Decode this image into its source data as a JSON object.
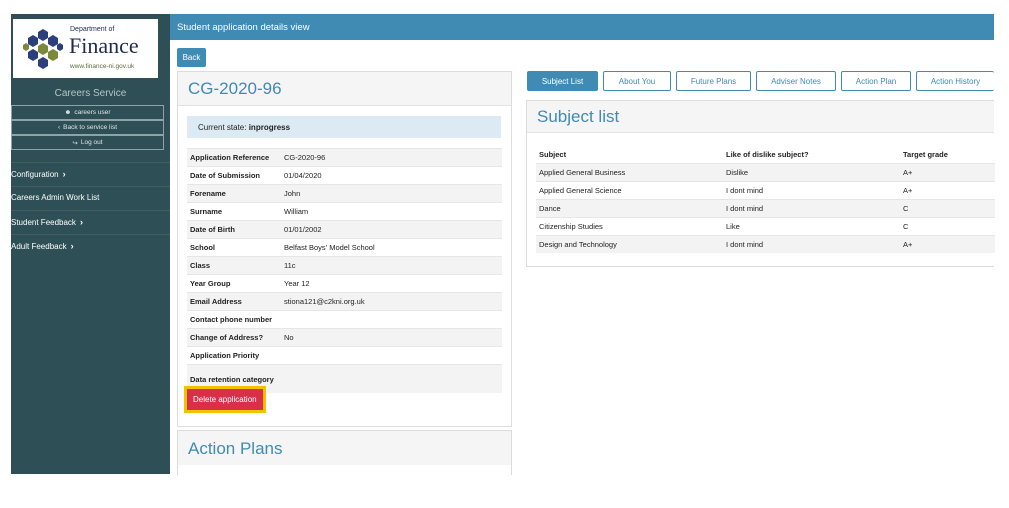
{
  "sidebar": {
    "logo": {
      "dept": "Department of",
      "name": "Finance",
      "url": "www.finance-ni.gov.uk"
    },
    "service_title": "Careers Service",
    "user_links": [
      {
        "icon": "user-icon",
        "glyph": "☻",
        "label": "careers user"
      },
      {
        "icon": "chevron-left-icon",
        "glyph": "‹",
        "label": "Back to service list"
      },
      {
        "icon": "logout-icon",
        "glyph": "↪",
        "label": "Log out"
      }
    ],
    "nav": [
      {
        "label": "Configuration",
        "chevron": "›"
      },
      {
        "label": "Careers Admin Work List",
        "chevron": ""
      },
      {
        "label": "Student Feedback",
        "chevron": "›"
      },
      {
        "label": "Adult Feedback",
        "chevron": "›"
      }
    ]
  },
  "header": {
    "title": "Student application details view",
    "back_label": "Back"
  },
  "application": {
    "reference_title": "CG-2020-96",
    "state_label": "Current state: ",
    "state_value": "inprogress",
    "details": [
      {
        "key": "Application Reference",
        "value": "CG-2020-96"
      },
      {
        "key": "Date of Submission",
        "value": "01/04/2020"
      },
      {
        "key": "Forename",
        "value": "John"
      },
      {
        "key": "Surname",
        "value": "William"
      },
      {
        "key": "Date of Birth",
        "value": "01/01/2002"
      },
      {
        "key": "School",
        "value": "Belfast Boys' Model School"
      },
      {
        "key": "Class",
        "value": "11c"
      },
      {
        "key": "Year Group",
        "value": "Year 12"
      },
      {
        "key": "Email Address",
        "value": "stiona121@c2kni.org.uk"
      },
      {
        "key": "Contact phone number",
        "value": ""
      },
      {
        "key": "Change of Address?",
        "value": "No"
      },
      {
        "key": "Application Priority",
        "value": ""
      },
      {
        "key": "Data retention category",
        "value": ""
      }
    ],
    "delete_label": "Delete application",
    "action_plans_title": "Action Plans"
  },
  "tabs": [
    {
      "label": "Subject List",
      "active": true
    },
    {
      "label": "About You",
      "active": false
    },
    {
      "label": "Future Plans",
      "active": false
    },
    {
      "label": "Adviser Notes",
      "active": false
    },
    {
      "label": "Action Plan",
      "active": false
    },
    {
      "label": "Action History",
      "active": false
    }
  ],
  "subject_list": {
    "title": "Subject list",
    "columns": [
      "Subject",
      "Like of dislike subject?",
      "Target grade"
    ],
    "rows": [
      [
        "Applied General Business",
        "Dislike",
        "A+"
      ],
      [
        "Applied General Science",
        "I dont mind",
        "A+"
      ],
      [
        "Dance",
        "I dont mind",
        "C"
      ],
      [
        "Citizenship Studies",
        "Like",
        "C"
      ],
      [
        "Design and Technology",
        "I dont mind",
        "A+"
      ]
    ]
  },
  "colors": {
    "primary": "#3f8bb4",
    "sidebar": "#2e4f55",
    "danger": "#d9304a",
    "highlight": "#f2c200",
    "state_bg": "#dcebf3"
  }
}
